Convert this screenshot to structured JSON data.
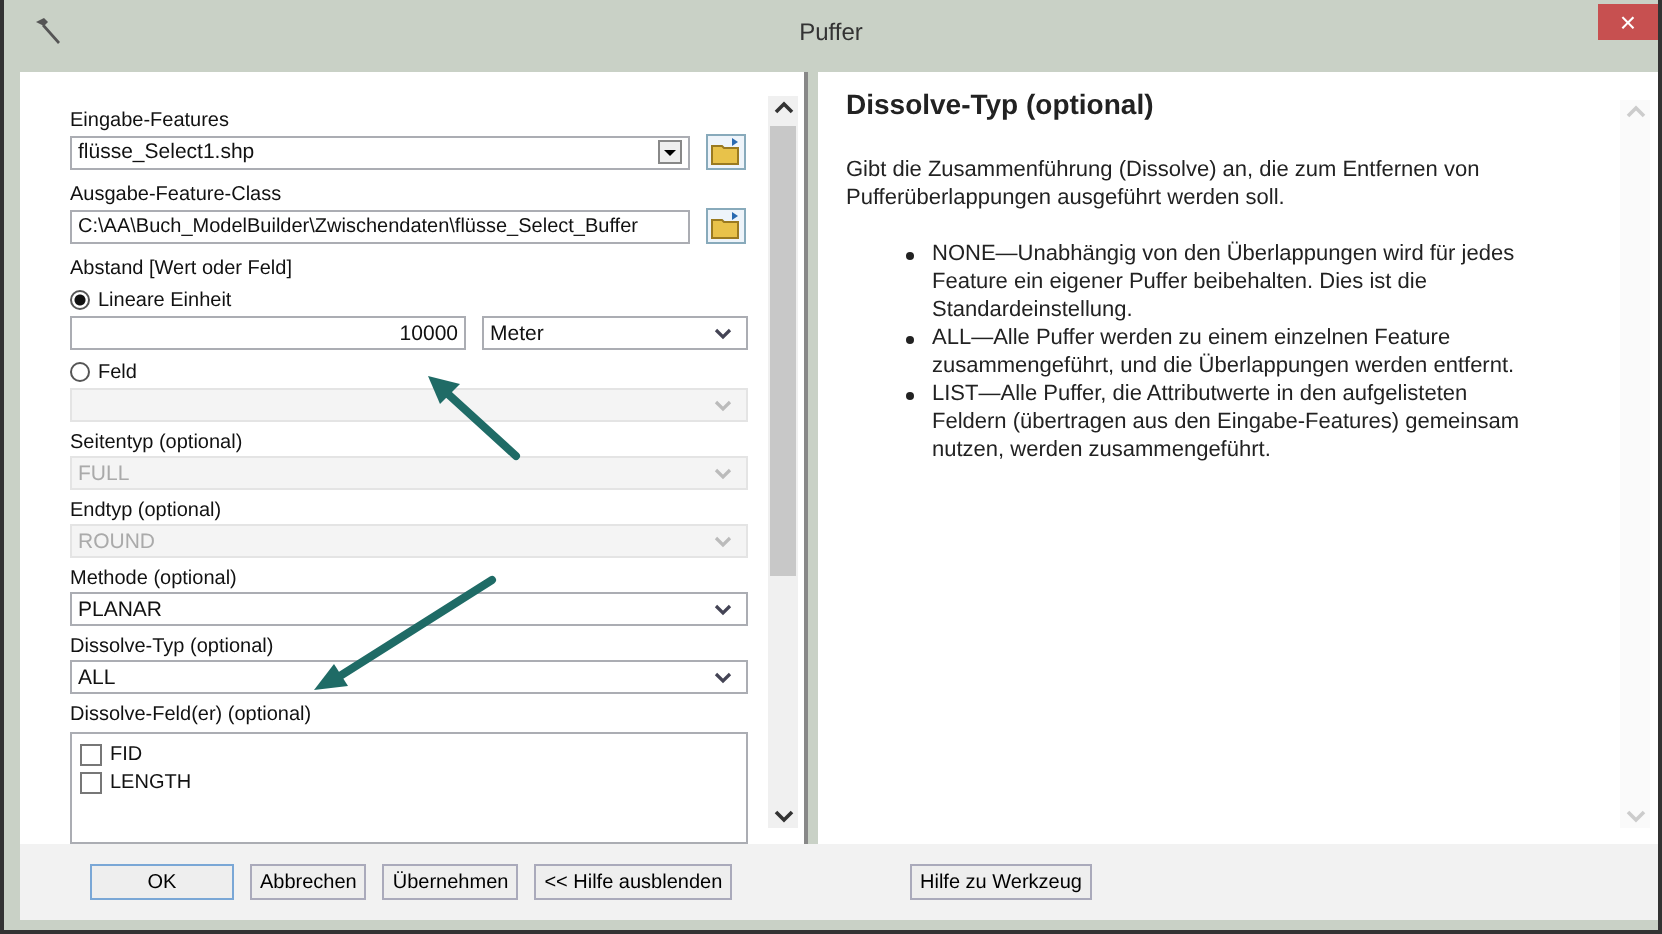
{
  "window": {
    "title": "Puffer",
    "close": "×"
  },
  "form": {
    "input_features": {
      "label": "Eingabe-Features",
      "value": "flüsse_Select1.shp"
    },
    "output_feature_class": {
      "label": "Ausgabe-Feature-Class",
      "value": "C:\\AA\\Buch_ModelBuilder\\Zwischendaten\\flüsse_Select_Buffer"
    },
    "distance": {
      "label": "Abstand [Wert oder Feld]",
      "options": [
        {
          "label": "Lineare Einheit",
          "selected": true
        },
        {
          "label": "Feld",
          "selected": false
        }
      ],
      "value": "10000",
      "unit": "Meter"
    },
    "dropdowns": [
      {
        "label": "Seitentyp (optional)",
        "value": "FULL",
        "disabled": true
      },
      {
        "label": "Endtyp (optional)",
        "value": "ROUND",
        "disabled": true
      },
      {
        "label": "Methode (optional)",
        "value": "PLANAR",
        "disabled": false
      },
      {
        "label": "Dissolve-Typ (optional)",
        "value": "ALL",
        "disabled": false
      }
    ],
    "dissolve_fields": {
      "label": "Dissolve-Feld(er) (optional)",
      "items": [
        {
          "label": "FID",
          "checked": false
        },
        {
          "label": "LENGTH",
          "checked": false
        }
      ]
    }
  },
  "help": {
    "title": "Dissolve-Typ (optional)",
    "intro": "Gibt die Zusammenführung (Dissolve) an, die zum Entfernen von Pufferüberlappungen ausgeführt werden soll.",
    "bullets": [
      "NONE—Unabhängig von den Überlappungen wird für jedes Feature ein eigener Puffer beibehalten. Dies ist die Standardeinstellung.",
      "ALL—Alle Puffer werden zu einem einzelnen Feature zusammengeführt, und die Überlappungen werden entfernt.",
      "LIST—Alle Puffer, die Attributwerte in den aufgelisteten Feldern (übertragen aus den Eingabe-Features) gemeinsam nutzen, werden zusammengeführt."
    ]
  },
  "buttons": [
    "OK",
    "Abbrechen",
    "Übernehmen",
    "<< Hilfe ausblenden"
  ],
  "help_button": "Hilfe zu Werkzeug"
}
